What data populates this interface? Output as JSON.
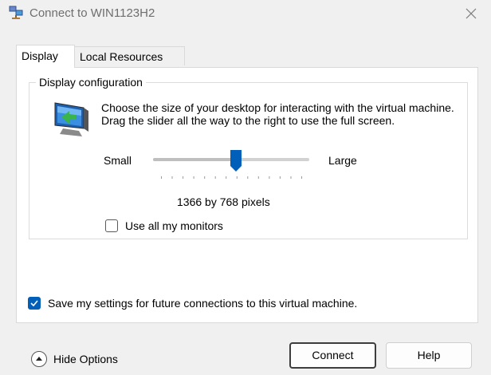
{
  "window": {
    "title": "Connect to WIN1123H2",
    "icon": "remote-desktop-icon",
    "close_icon": "close-icon"
  },
  "tabs": [
    {
      "label": "Display",
      "active": true
    },
    {
      "label": "Local Resources",
      "active": false
    }
  ],
  "display_config": {
    "group_title": "Display configuration",
    "description": "Choose the size of your desktop for interacting with the virtual machine. Drag the slider all the way to the right to use the full screen.",
    "slider": {
      "min_label": "Small",
      "max_label": "Large",
      "ticks": 14,
      "value_fraction": 0.53
    },
    "resolution_text": "1366 by 768 pixels",
    "use_all_monitors": {
      "label": "Use all my monitors",
      "checked": false
    }
  },
  "save_settings": {
    "label": "Save my settings for future connections to this virtual machine.",
    "checked": true
  },
  "footer": {
    "hide_options_label": "Hide Options",
    "connect_label": "Connect",
    "help_label": "Help"
  },
  "colors": {
    "accent": "#005fb8",
    "window_bg": "#f0f0f0",
    "title_text": "#6e6e6e"
  }
}
